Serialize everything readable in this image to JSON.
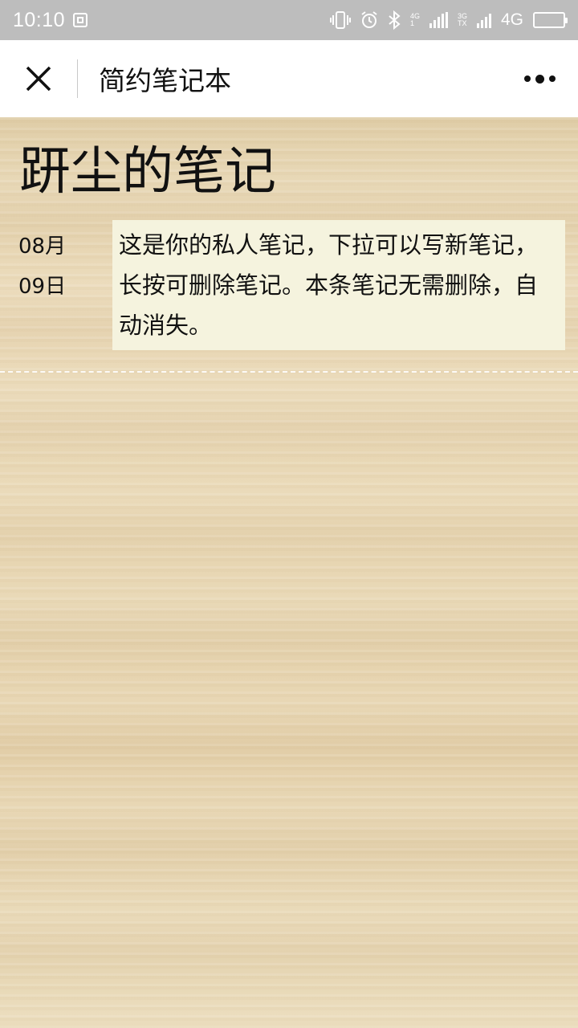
{
  "status_bar": {
    "time": "10:10",
    "network_mini_top": "4G",
    "network_mini_bottom": "1",
    "network_mini2_top": "3G",
    "network_mini2_bottom": "TX",
    "network_type": "4G",
    "battery_level": 0.95,
    "icons": [
      "screenshot-icon",
      "vibrate-icon",
      "alarm-icon",
      "bluetooth-icon",
      "signal-icon",
      "signal-icon",
      "battery-icon"
    ]
  },
  "title_bar": {
    "title": "简约笔记本",
    "close_icon": "close-icon",
    "more_icon": "more-icon"
  },
  "notebook": {
    "title": "趼尘的笔记",
    "notes": [
      {
        "month": "08月",
        "day": "09日",
        "text": "这是你的私人笔记，下拉可以写新笔记，长按可删除笔记。本条笔记无需删除，自动消失。"
      }
    ]
  },
  "colors": {
    "status_bar_bg": "#bdbdbd",
    "title_bar_bg": "#ffffff",
    "note_card_bg": "#f5f3de",
    "wood_bg": "#e7d6b3",
    "text": "#111111"
  }
}
